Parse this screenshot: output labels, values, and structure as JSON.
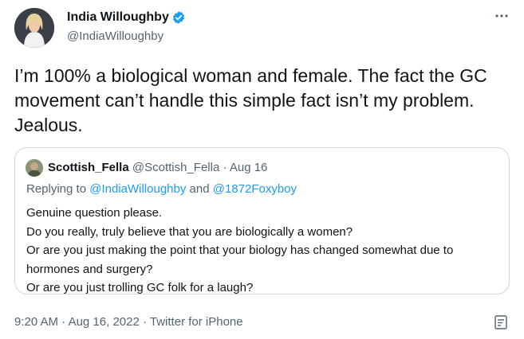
{
  "author": {
    "display_name": "India Willoughby",
    "handle": "@IndiaWilloughby",
    "verified": true
  },
  "tweet": {
    "text": "I’m 100% a biological woman and female. The fact the GC movement can’t handle this simple fact isn’t my problem. Jealous."
  },
  "quote": {
    "display_name": "Scottish_Fella",
    "handle": "@Scottish_Fella",
    "separator": "·",
    "date": "Aug 16",
    "replying_label": "Replying to",
    "mention_1": "@IndiaWilloughby",
    "and_label": "and",
    "mention_2": "@1872Foxyboy",
    "lines": [
      "Genuine question please.",
      "Do you really, truly believe that you are biologically a women?",
      "Or are you just making the point that your biology has changed somewhat due to",
      "hormones and surgery?",
      "Or are you just trolling GC folk for a laugh?"
    ]
  },
  "meta": {
    "time": "9:20 AM",
    "sep1": "·",
    "date": "Aug 16, 2022",
    "sep2": "·",
    "source": "Twitter for iPhone"
  },
  "colors": {
    "verified_blue": "#1d9bf0",
    "secondary_text": "#536471",
    "border": "#cfd9de"
  },
  "icons": {
    "more": "more-horizontal-icon",
    "verified": "verified-badge-icon",
    "analytics": "analytics-icon"
  }
}
